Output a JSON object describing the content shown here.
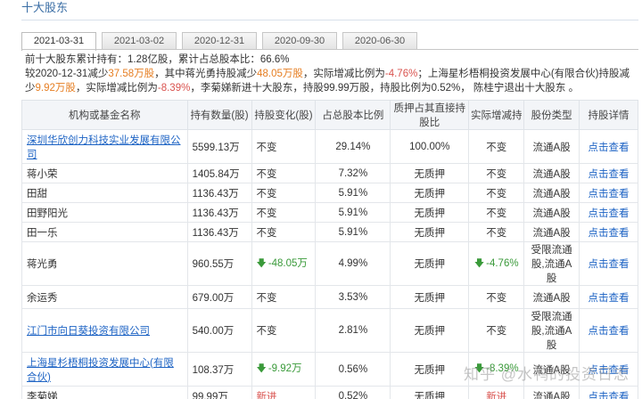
{
  "section_title": "十大股东",
  "tabs": [
    {
      "label": "2021-03-31",
      "active": true
    },
    {
      "label": "2021-03-02",
      "active": false
    },
    {
      "label": "2020-12-31",
      "active": false
    },
    {
      "label": "2020-09-30",
      "active": false
    },
    {
      "label": "2020-06-30",
      "active": false
    }
  ],
  "summary": {
    "p1": "前十大股东累计持有：",
    "total_shares": "1.28亿股",
    "p2": "，累计占总股本比：",
    "total_ratio": "66.6%",
    "p3": "较2020-12-31减少",
    "reduce_total": "37.58万股",
    "p4": "，其中蒋光勇持股减少",
    "jiang_reduce": "48.05万股",
    "p5": "，实际增减比例为",
    "jiang_ratio": "-4.76%",
    "p6": "；上海星杉梧桐投资发展中心(有限合伙)持股减少",
    "shanghai_reduce": "9.92万股",
    "p7": "，实际增减比例为",
    "shanghai_ratio": "-8.39%",
    "p8": "，李菊娣新进十大股东，持股99.99万股，持股比例为0.52%， 陈桂宁退出十大股东 。"
  },
  "table": {
    "headers": [
      "机构或基金名称",
      "持有数量(股)",
      "持股变化(股)",
      "占总股本比例",
      "质押占其直接持股比",
      "实际增减持",
      "股份类型",
      "持股详情"
    ],
    "rows": [
      {
        "name": "深圳华欣创力科技实业发展有限公司",
        "link": true,
        "qty": "5599.13万",
        "change": "不变",
        "change_dir": "",
        "ratio": "29.14%",
        "pledge": "100.00%",
        "actual": "不变",
        "actual_dir": "",
        "type": "流通A股",
        "detail": "点击查看"
      },
      {
        "name": "蒋小荣",
        "link": false,
        "qty": "1405.84万",
        "change": "不变",
        "change_dir": "",
        "ratio": "7.32%",
        "pledge": "无质押",
        "actual": "不变",
        "actual_dir": "",
        "type": "流通A股",
        "detail": "点击查看"
      },
      {
        "name": "田甜",
        "link": false,
        "qty": "1136.43万",
        "change": "不变",
        "change_dir": "",
        "ratio": "5.91%",
        "pledge": "无质押",
        "actual": "不变",
        "actual_dir": "",
        "type": "流通A股",
        "detail": "点击查看"
      },
      {
        "name": "田野阳光",
        "link": false,
        "qty": "1136.43万",
        "change": "不变",
        "change_dir": "",
        "ratio": "5.91%",
        "pledge": "无质押",
        "actual": "不变",
        "actual_dir": "",
        "type": "流通A股",
        "detail": "点击查看"
      },
      {
        "name": "田一乐",
        "link": false,
        "qty": "1136.43万",
        "change": "不变",
        "change_dir": "",
        "ratio": "5.91%",
        "pledge": "无质押",
        "actual": "不变",
        "actual_dir": "",
        "type": "流通A股",
        "detail": "点击查看"
      },
      {
        "name": "蒋光勇",
        "link": false,
        "qty": "960.55万",
        "change": "-48.05万",
        "change_dir": "down",
        "ratio": "4.99%",
        "pledge": "无质押",
        "actual": "-4.76%",
        "actual_dir": "down",
        "type": "受限流通股,流通A股",
        "detail": "点击查看"
      },
      {
        "name": "余运秀",
        "link": false,
        "qty": "679.00万",
        "change": "不变",
        "change_dir": "",
        "ratio": "3.53%",
        "pledge": "无质押",
        "actual": "不变",
        "actual_dir": "",
        "type": "流通A股",
        "detail": "点击查看"
      },
      {
        "name": "江门市向日葵投资有限公司",
        "link": true,
        "qty": "540.00万",
        "change": "不变",
        "change_dir": "",
        "ratio": "2.81%",
        "pledge": "无质押",
        "actual": "不变",
        "actual_dir": "",
        "type": "受限流通股,流通A股",
        "detail": "点击查看"
      },
      {
        "name": "上海星杉梧桐投资发展中心(有限合伙)",
        "link": true,
        "qty": "108.37万",
        "change": "-9.92万",
        "change_dir": "down",
        "ratio": "0.56%",
        "pledge": "无质押",
        "actual": "-8.39%",
        "actual_dir": "down",
        "type": "流通A股",
        "detail": "点击查看"
      },
      {
        "name": "李菊娣",
        "link": false,
        "qty": "99.99万",
        "change": "新进",
        "change_dir": "up",
        "ratio": "0.52%",
        "pledge": "无质押",
        "actual": "新进",
        "actual_dir": "up",
        "type": "流通A股",
        "detail": "点击查看"
      }
    ]
  },
  "watermark": "知乎 @水鸭的投资日志",
  "colors": {
    "link": "#1d63c4",
    "down": "#3a9a3a",
    "up": "#d9534f",
    "orange": "#e67e22"
  }
}
